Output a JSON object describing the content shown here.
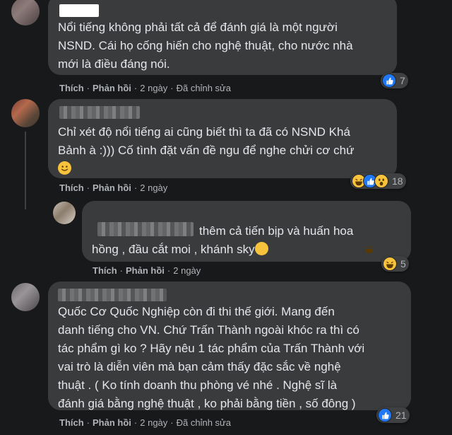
{
  "comments": [
    {
      "text": "Nổi tiếng không phải tất cả để đánh giá là một người\nNSND. Cái họ cống hiến cho nghệ thuật, cho nước nhà\nmới là điều đáng nói.",
      "like_label": "Thích",
      "reply_label": "Phản hồi",
      "time": "2 ngày",
      "edited": "Đã chỉnh sửa",
      "reaction_count": "7",
      "reactions": [
        "like-icon"
      ]
    },
    {
      "text": "Chỉ xét độ nổi tiếng ai cũng biết thì ta đã có NSND Khá\nBảnh à :))) Cố tình đặt vấn đề ngu để nghe chửi cơ chứ",
      "like_label": "Thích",
      "reply_label": "Phản hồi",
      "time": "2 ngày",
      "reaction_count": "18",
      "reactions": [
        "haha-icon",
        "like-icon",
        "wow-icon"
      ]
    },
    {
      "text": "thêm cả tiến bịp và huấn hoa\nhồng , đầu cắt moi , khánh sky",
      "like_label": "Thích",
      "reply_label": "Phản hồi",
      "time": "2 ngày",
      "reaction_count": "5",
      "reactions": [
        "haha-icon"
      ]
    },
    {
      "text": "Quốc Cơ Quốc Nghiệp còn đi thi thế giới. Mang đến\ndanh tiếng cho VN. Chứ Trấn Thành ngoài khóc ra thì có\ntác phẩm gì ko ? Hãy nêu 1 tác phẩm của Trấn Thành với\nvai trò là diễn viên mà bạn cảm thấy đặc sắc về nghệ\nthuật . ( Ko tính doanh thu phòng vé nhé . Nghệ sĩ là\nđánh giá bằng nghệ thuật , ko phải bằng tiền , số đông )",
      "like_label": "Thích",
      "reply_label": "Phản hồi",
      "time": "2 ngày",
      "edited": "Đã chỉnh sửa",
      "reaction_count": "21",
      "reactions": [
        "like-icon"
      ]
    }
  ],
  "colors": {
    "background": "#18191a",
    "bubble": "#3a3b3c",
    "text": "#e4e6eb",
    "muted": "#b0b3b8",
    "like": "#2078f4",
    "haha": "#f7c33c"
  }
}
